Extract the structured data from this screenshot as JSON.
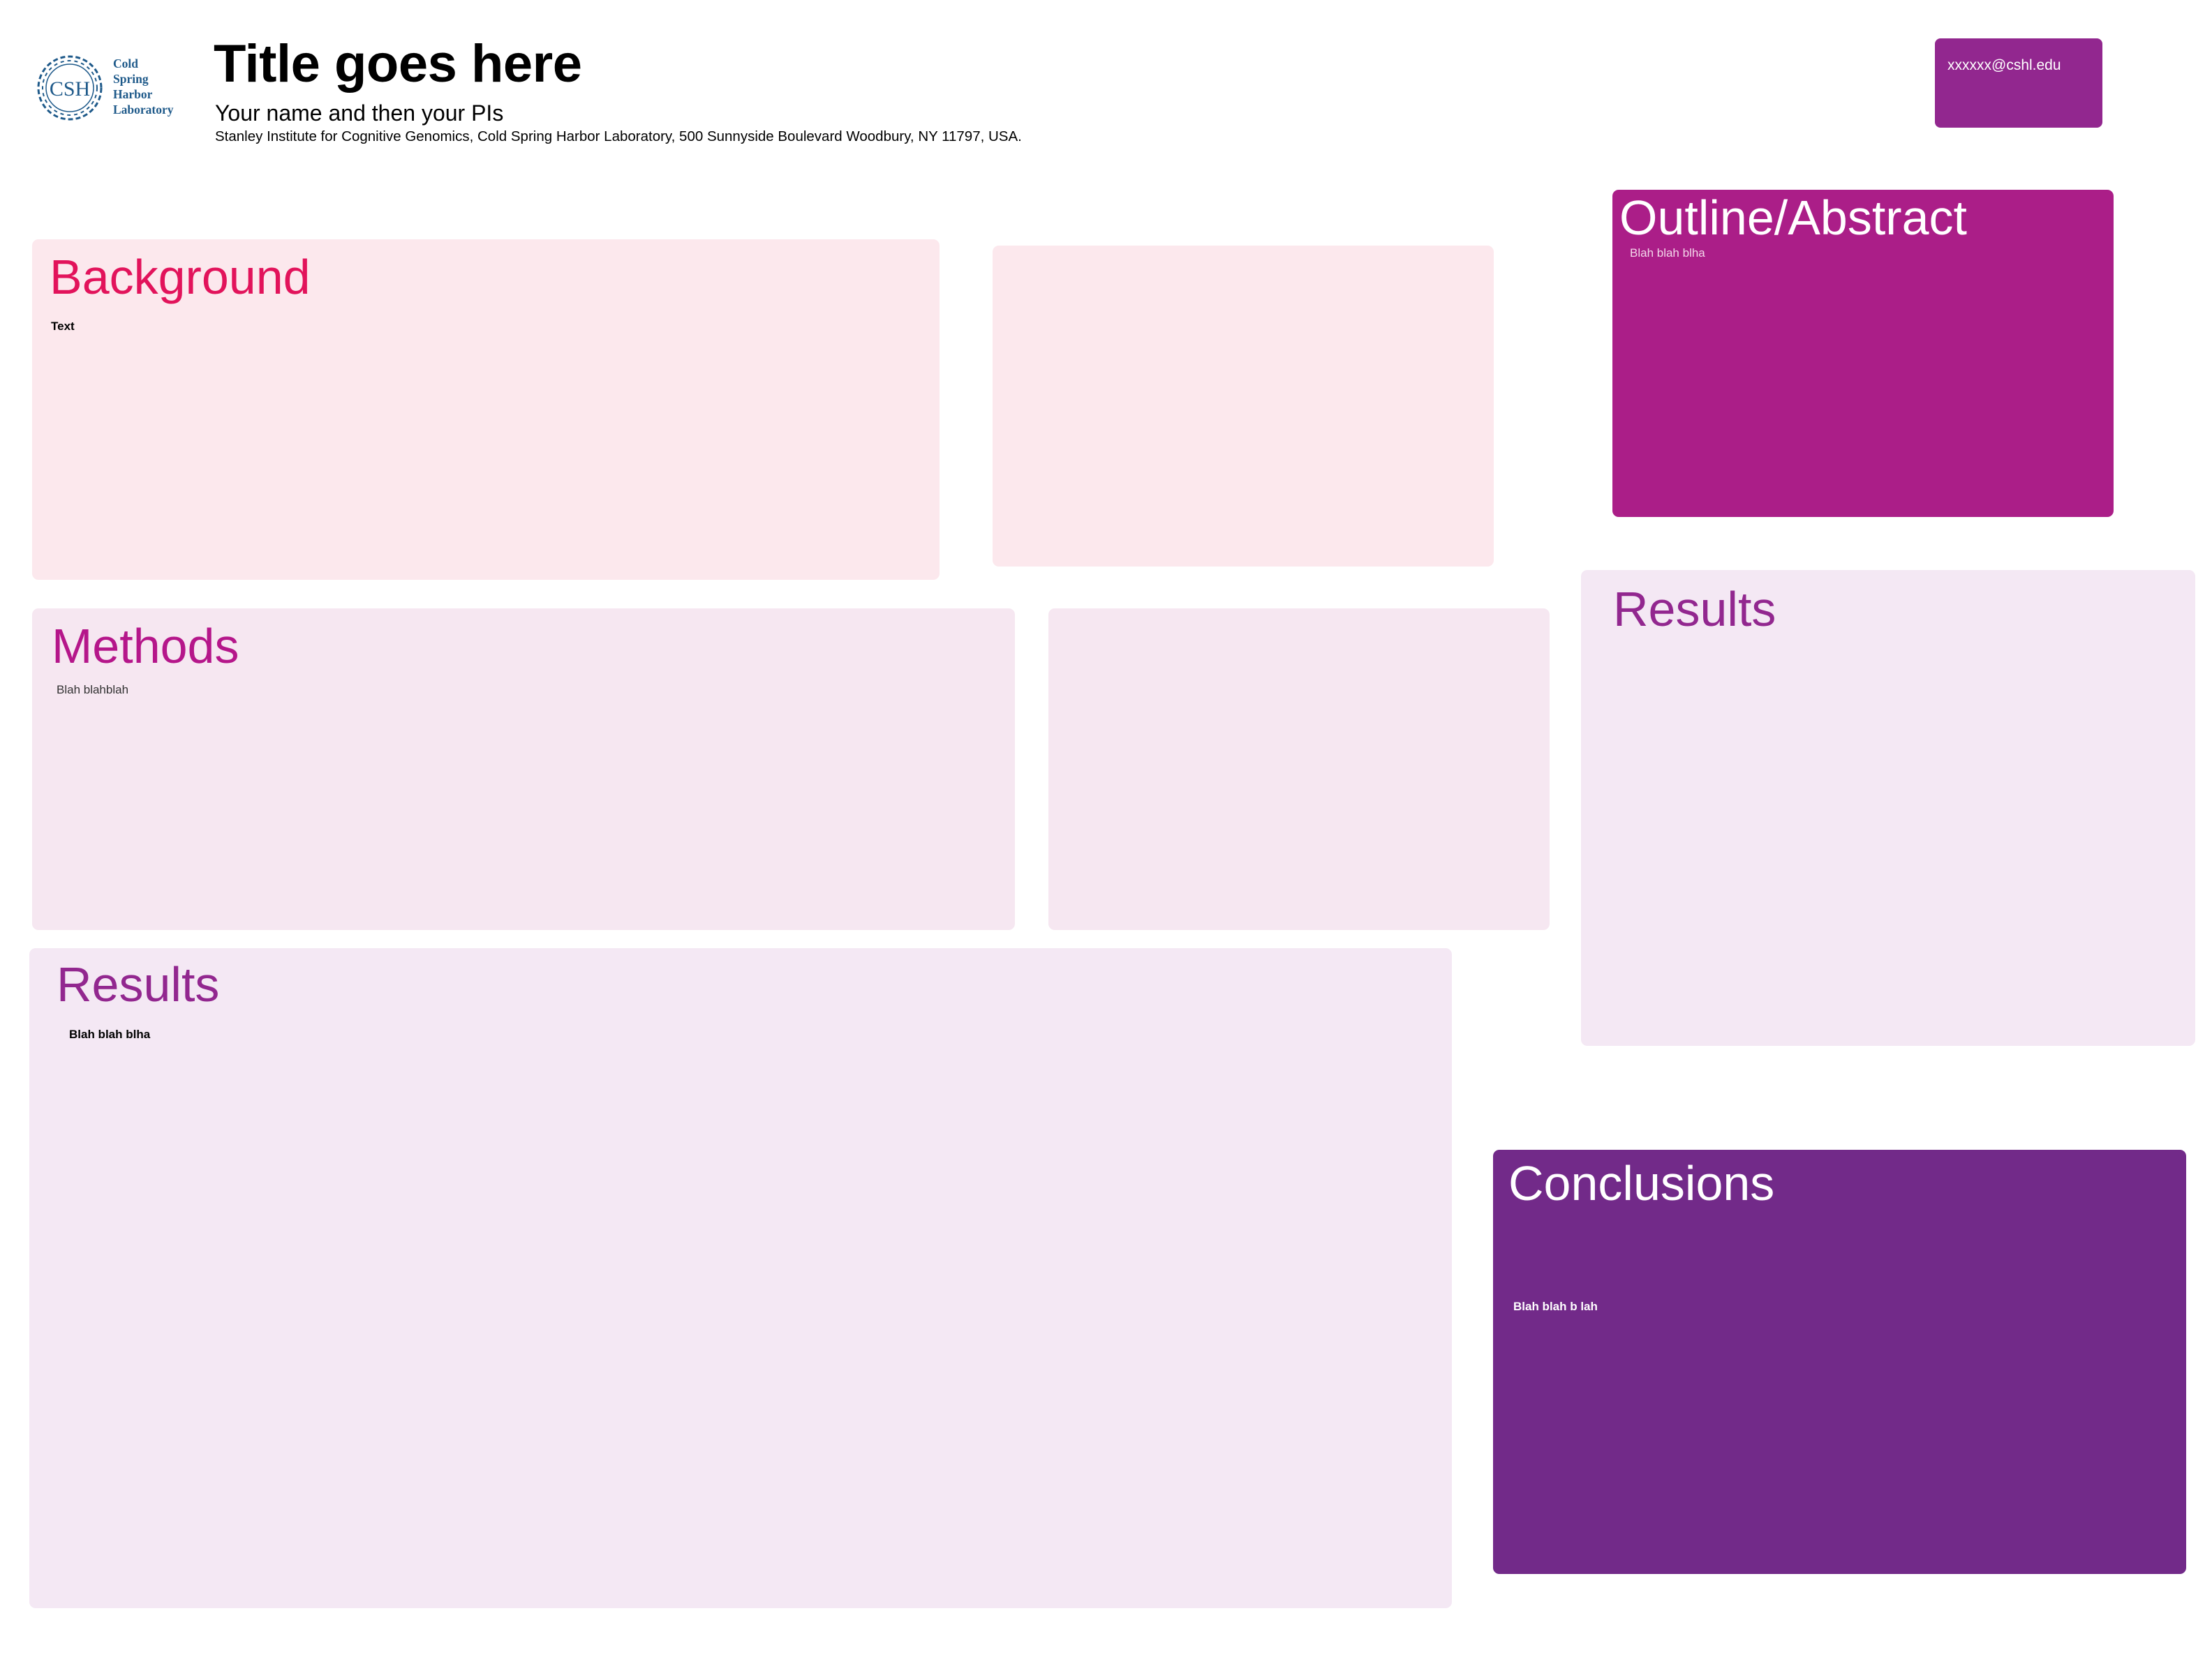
{
  "logo": {
    "seal_text": "CSH",
    "lines": [
      "Cold",
      "Spring",
      "Harbor",
      "Laboratory"
    ],
    "color": "#1f5a8a"
  },
  "header": {
    "title": "Title goes here",
    "authors": "Your name and then your PIs",
    "affiliation": "Stanley Institute for Cognitive Genomics, Cold Spring Harbor Laboratory, 500 Sunnyside Boulevard Woodbury, NY 11797, USA.",
    "email": "xxxxxx@cshl.edu"
  },
  "sections": {
    "background": {
      "title": "Background",
      "body": "Text",
      "title_color": "#e2135b",
      "fill": "#fce8ed"
    },
    "background_side": {
      "fill": "#fce8ed"
    },
    "outline": {
      "title": "Outline/Abstract",
      "body": "Blah blah blha",
      "title_color": "#ffffff",
      "fill": "#ab1e88"
    },
    "methods": {
      "title": "Methods",
      "body": "Blah blahblah",
      "title_color": "#b5168a",
      "fill": "#f6e7f1"
    },
    "methods_side": {
      "fill": "#f6e7f1"
    },
    "results_right": {
      "title": "Results",
      "title_color": "#92278f",
      "fill": "#f4e8f4"
    },
    "results_main": {
      "title": "Results",
      "body": "Blah blah blha",
      "title_color": "#92278f",
      "fill": "#f4e8f4"
    },
    "conclusions": {
      "title": "Conclusions",
      "body": "Blah blah b lah",
      "title_color": "#ffffff",
      "fill": "#722a89"
    }
  },
  "colors": {
    "email_box": "#92278f",
    "header_text": "#000000"
  }
}
